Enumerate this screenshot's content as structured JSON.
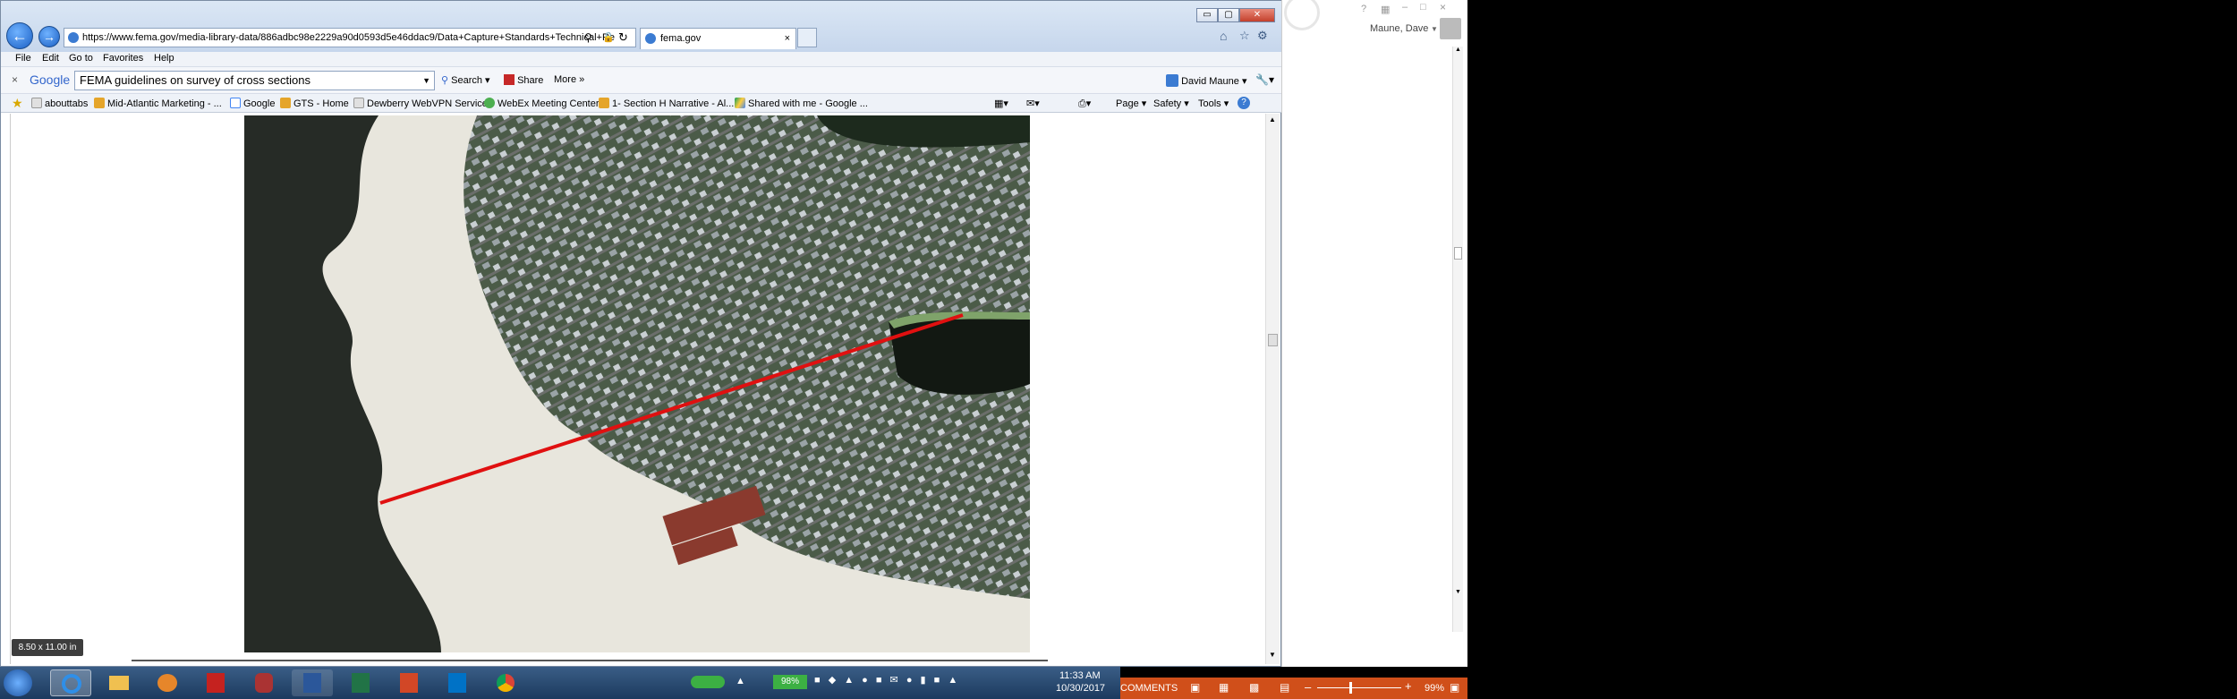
{
  "browser": {
    "url": "https://www.fema.gov/media-library-data/886adbc98e2229a90d0593d5e46ddac9/Data+Capture+Standards+Technical+Re",
    "tab_title": "fema.gov",
    "window_buttons": [
      "▭",
      "▢",
      "✕"
    ]
  },
  "menu": [
    "File",
    "Edit",
    "Go to",
    "Favorites",
    "Help"
  ],
  "google_toolbar": {
    "brand": "Google",
    "query": "FEMA guidelines on survey of cross sections",
    "search_label": "Search",
    "share_label": "Share",
    "more_label": "More",
    "user": "David Maune"
  },
  "favorites": [
    "abouttabs",
    "Mid-Atlantic Marketing - ...",
    "Google",
    "GTS - Home",
    "Dewberry WebVPN Service",
    "WebEx Meeting Center",
    "1- Section H Narrative - Al...",
    "Shared with me - Google ..."
  ],
  "command_bar": [
    "Page",
    "Safety",
    "Tools"
  ],
  "page": {
    "size_badge": "8.50 x 11.00 in"
  },
  "right_pane": {
    "user": "Maune, Dave"
  },
  "taskbar": {
    "battery": "98%",
    "time": "11:33 AM",
    "date": "10/30/2017"
  },
  "word_status": {
    "comments": "COMMENTS",
    "zoom": "99%"
  },
  "colors": {
    "transect": "#e01010",
    "word_status_bg": "#d04f1a"
  }
}
